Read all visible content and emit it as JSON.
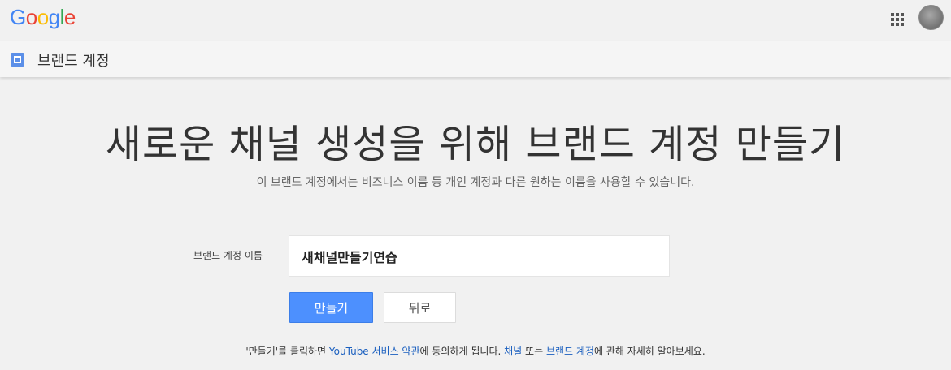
{
  "header": {
    "logo_letters": [
      "G",
      "o",
      "o",
      "g",
      "l",
      "e"
    ],
    "apps_icon": "apps-grid-icon",
    "avatar_icon": "user-avatar"
  },
  "subbar": {
    "icon": "brand-account-icon",
    "title": "브랜드 계정"
  },
  "main": {
    "headline": "새로운 채널 생성을 위해 브랜드 계정 만들기",
    "subtext": "이 브랜드 계정에서는 비즈니스 이름 등 개인 계정과 다른 원하는 이름을 사용할 수 있습니다.",
    "field_label": "브랜드 계정 이름",
    "field_value": "새채널만들기연습",
    "create_button": "만들기",
    "back_button": "뒤로"
  },
  "footer": {
    "part1": "'만들기'를 클릭하면 ",
    "link_terms": "YouTube 서비스 약관",
    "part2": "에 동의하게 됩니다. ",
    "link_channel": "채널",
    "part3": " 또는 ",
    "link_brand": "브랜드 계정",
    "part4": "에 관해 자세히 알아보세요."
  },
  "colors": {
    "primary_button": "#4d90fe",
    "link": "#1a5fbf",
    "background": "#f1f1f1"
  }
}
